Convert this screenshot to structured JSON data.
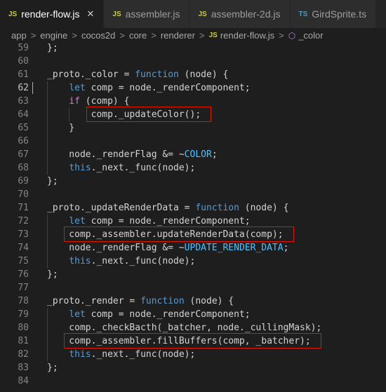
{
  "tabs": [
    {
      "badge": "JS",
      "label": "render-flow.js",
      "close": "✕",
      "active": true
    },
    {
      "badge": "JS",
      "label": "assembler.js",
      "active": false
    },
    {
      "badge": "JS",
      "label": "assembler-2d.js",
      "active": false
    },
    {
      "badge": "TS",
      "label": "GirdSprite.ts",
      "active": false
    }
  ],
  "breadcrumb": {
    "segments": [
      "app",
      "engine",
      "cocos2d",
      "core",
      "renderer"
    ],
    "file_badge": "JS",
    "file": "render-flow.js",
    "symbol": "_color",
    "separator": ">"
  },
  "editor": {
    "lines": [
      {
        "no": "59",
        "code": "};"
      },
      {
        "no": "60",
        "code": ""
      },
      {
        "no": "61",
        "code": "_proto._color = function (node) {"
      },
      {
        "no": "62",
        "code": "    let comp = node._renderComponent;"
      },
      {
        "no": "63",
        "code": "    if (comp) {"
      },
      {
        "no": "64",
        "code": "        comp._updateColor();"
      },
      {
        "no": "65",
        "code": "    }"
      },
      {
        "no": "66",
        "code": ""
      },
      {
        "no": "67",
        "code": "    node._renderFlag &= ~COLOR;"
      },
      {
        "no": "68",
        "code": "    this._next._func(node);"
      },
      {
        "no": "69",
        "code": "};"
      },
      {
        "no": "70",
        "code": ""
      },
      {
        "no": "71",
        "code": "_proto._updateRenderData = function (node) {"
      },
      {
        "no": "72",
        "code": "    let comp = node._renderComponent;"
      },
      {
        "no": "73",
        "code": "    comp._assembler.updateRenderData(comp);"
      },
      {
        "no": "74",
        "code": "    node._renderFlag &= ~UPDATE_RENDER_DATA;"
      },
      {
        "no": "75",
        "code": "    this._next._func(node);"
      },
      {
        "no": "76",
        "code": "};"
      },
      {
        "no": "77",
        "code": ""
      },
      {
        "no": "78",
        "code": "_proto._render = function (node) {"
      },
      {
        "no": "79",
        "code": "    let comp = node._renderComponent;"
      },
      {
        "no": "80",
        "code": "    comp._checkBacth(_batcher, node._cullingMask);"
      },
      {
        "no": "81",
        "code": "    comp._assembler.fillBuffers(comp, _batcher);"
      },
      {
        "no": "82",
        "code": "    this._next._func(node);"
      },
      {
        "no": "83",
        "code": "};"
      },
      {
        "no": "84",
        "code": ""
      }
    ],
    "current_line": "62",
    "highlight_color": "#e51400"
  },
  "colors": {
    "background": "#1e1e1e",
    "keyword": "#569cd6",
    "control": "#c586c0",
    "constant": "#4fc1ff",
    "text": "#d4d4d4",
    "line_number": "#858585"
  }
}
